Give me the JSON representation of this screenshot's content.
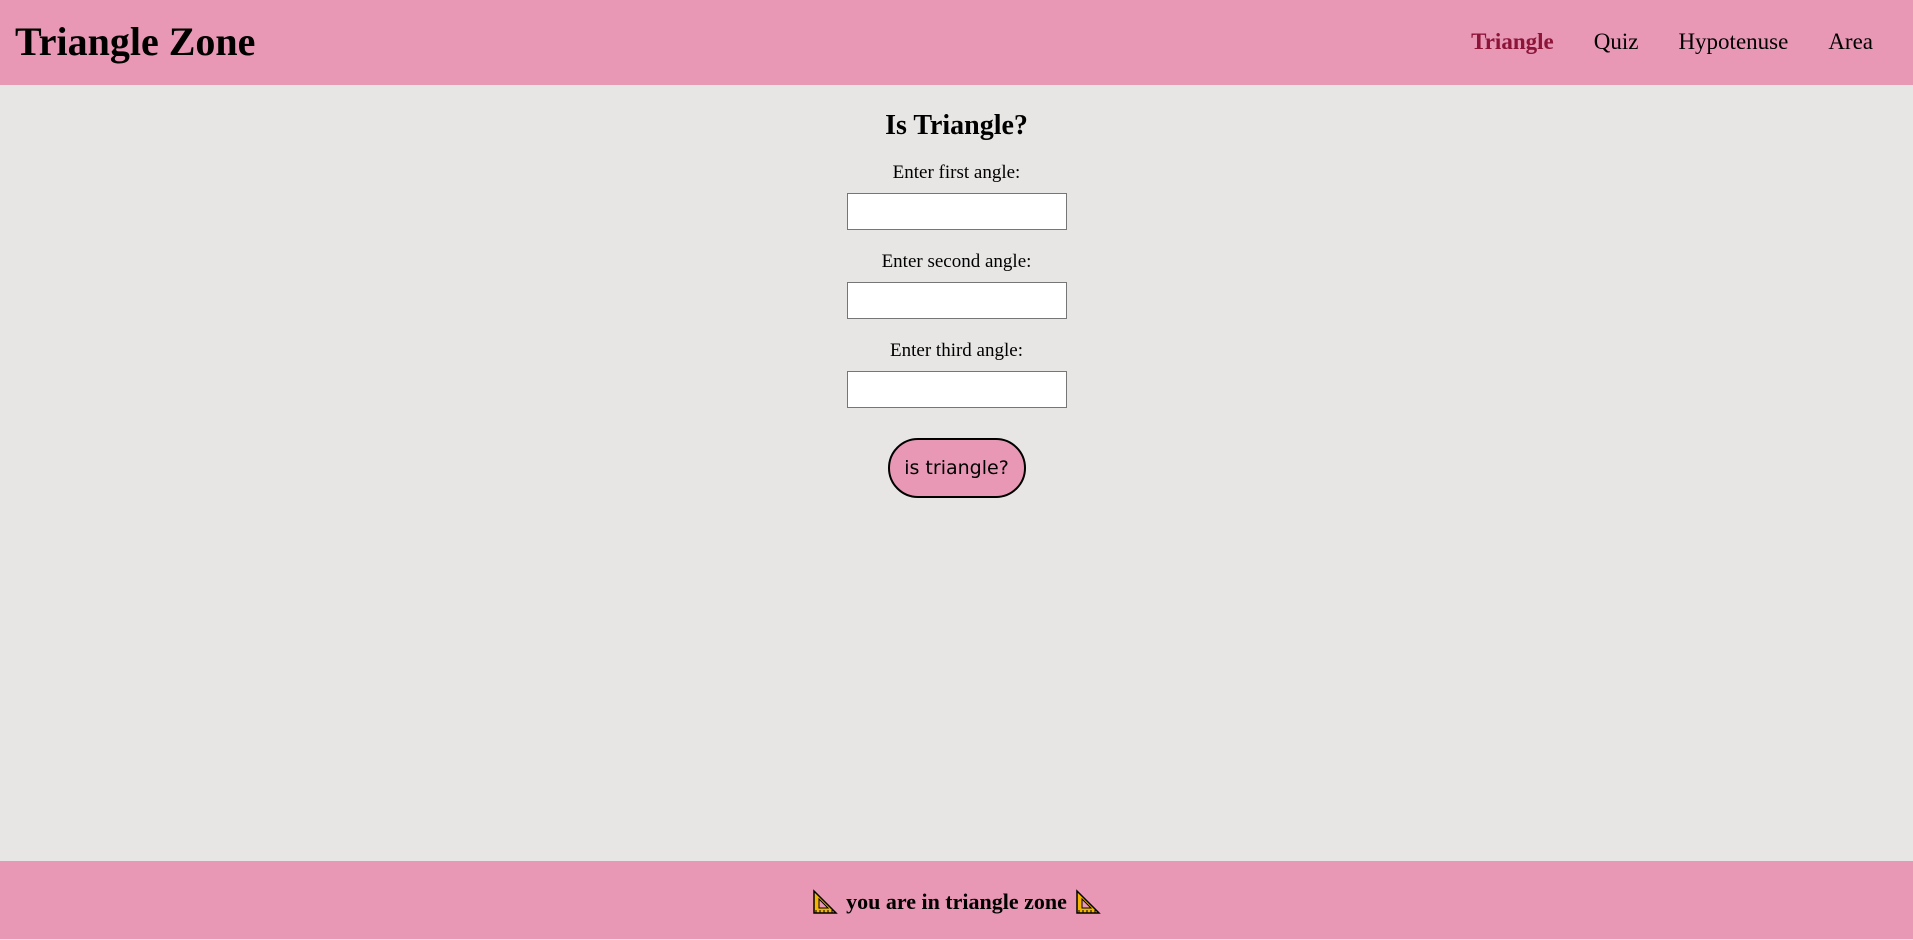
{
  "brand": {
    "title": "Triangle Zone"
  },
  "nav": {
    "items": [
      {
        "label": "Triangle",
        "active": true
      },
      {
        "label": "Quiz",
        "active": false
      },
      {
        "label": "Hypotenuse",
        "active": false
      },
      {
        "label": "Area",
        "active": false
      }
    ]
  },
  "main": {
    "heading": "Is Triangle?",
    "fields": [
      {
        "label": "Enter first angle:",
        "value": "",
        "placeholder": ""
      },
      {
        "label": "Enter second angle:",
        "value": "",
        "placeholder": ""
      },
      {
        "label": "Enter third angle:",
        "value": "",
        "placeholder": ""
      }
    ],
    "button_label": "is triangle?"
  },
  "footer": {
    "text": "you are in triangle zone",
    "icon": "triangular-ruler-icon"
  },
  "colors": {
    "nav_bg": "#e898b5",
    "page_bg": "#e7e6e5",
    "active_link": "#8b1438",
    "button_bg": "#e898b5"
  }
}
